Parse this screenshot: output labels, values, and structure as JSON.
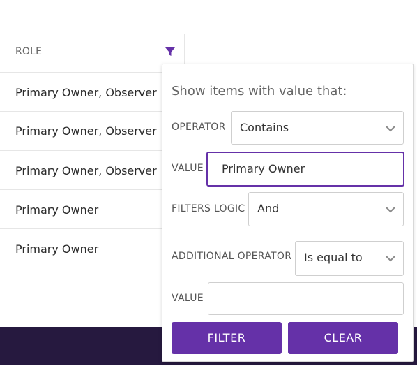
{
  "grid": {
    "column_header": "ROLE",
    "rows": [
      "Primary Owner, Observer",
      "Primary Owner, Observer",
      "Primary Owner, Observer",
      "Primary Owner",
      "Primary Owner"
    ]
  },
  "filter_popup": {
    "title": "Show items with value that:",
    "operator_label": "OPERATOR",
    "operator_value": "Contains",
    "value_label": "VALUE",
    "value_text": "Primary Owner",
    "logic_label": "FILTERS LOGIC",
    "logic_value": "And",
    "additional_operator_label": "ADDITIONAL OPERATOR",
    "additional_operator_value": "Is equal to",
    "second_value_label": "VALUE",
    "second_value_text": "",
    "filter_button": "FILTER",
    "clear_button": "CLEAR"
  },
  "colors": {
    "accent": "#6531a8",
    "footer": "#26193f"
  },
  "icons": {
    "filter": "filter-icon",
    "chevron": "chevron-down-icon"
  }
}
